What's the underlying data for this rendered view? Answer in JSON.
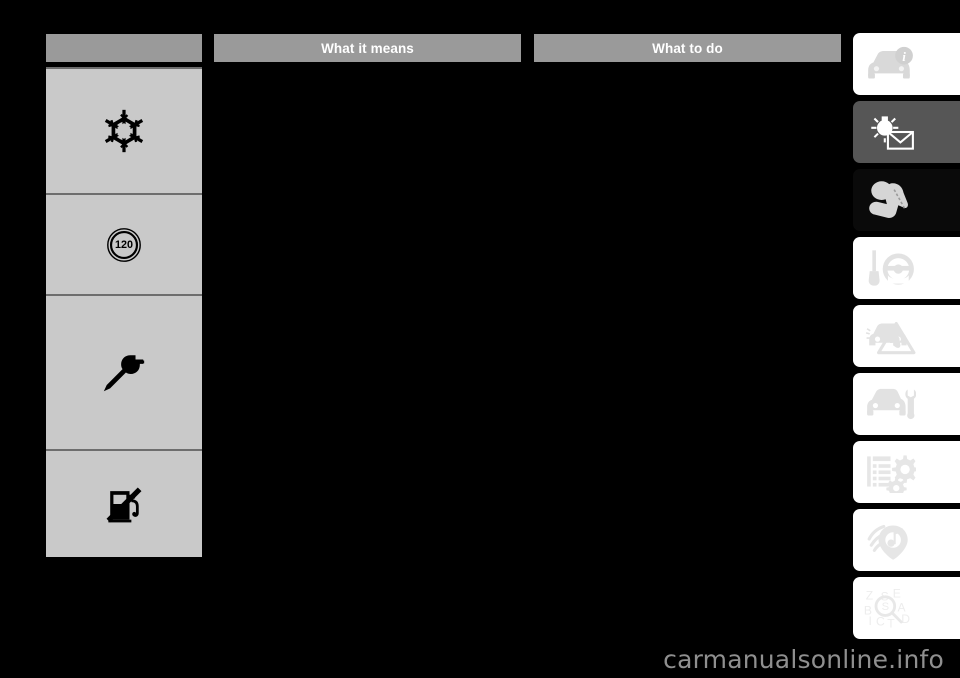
{
  "page": {
    "background_color": "#000000",
    "watermark": "carmanualsonline.info"
  },
  "table": {
    "header_bg": "#9a9a9a",
    "header_text_color": "#ffffff",
    "cell_bg": "#c9c9c9",
    "columns": [
      {
        "id": "symbol",
        "label": ""
      },
      {
        "id": "means",
        "label": "What it means"
      },
      {
        "id": "to_do",
        "label": "What to do"
      }
    ],
    "rows": [
      {
        "symbol_icon": "snowflake-icon",
        "what_it_means": "",
        "what_to_do": ""
      },
      {
        "symbol_icon": "speed-limit-120-icon",
        "what_it_means": "",
        "what_to_do": ""
      },
      {
        "symbol_icon": "wrench-service-icon",
        "what_it_means": "",
        "what_to_do": ""
      },
      {
        "symbol_icon": "fuel-pump-crossed-icon",
        "what_it_means": "",
        "what_to_do": ""
      }
    ]
  },
  "tab_rail": {
    "tabs": [
      {
        "icon": "car-info-icon",
        "state": "light",
        "bg": "#ffffff"
      },
      {
        "icon": "lamp-envelope-icon",
        "state": "grey",
        "bg": "#565656"
      },
      {
        "icon": "child-seat-safety-icon",
        "state": "black",
        "bg": "#0a0a0a"
      },
      {
        "icon": "key-steering-wheel-icon",
        "state": "light",
        "bg": "#ffffff"
      },
      {
        "icon": "car-breakdown-warning-icon",
        "state": "light",
        "bg": "#ffffff"
      },
      {
        "icon": "car-service-wrench-icon",
        "state": "light",
        "bg": "#ffffff"
      },
      {
        "icon": "specifications-gears-icon",
        "state": "light",
        "bg": "#ffffff"
      },
      {
        "icon": "audio-multimedia-icon",
        "state": "light",
        "bg": "#ffffff"
      },
      {
        "icon": "alphabetical-index-icon",
        "state": "light",
        "bg": "#ffffff"
      }
    ]
  }
}
